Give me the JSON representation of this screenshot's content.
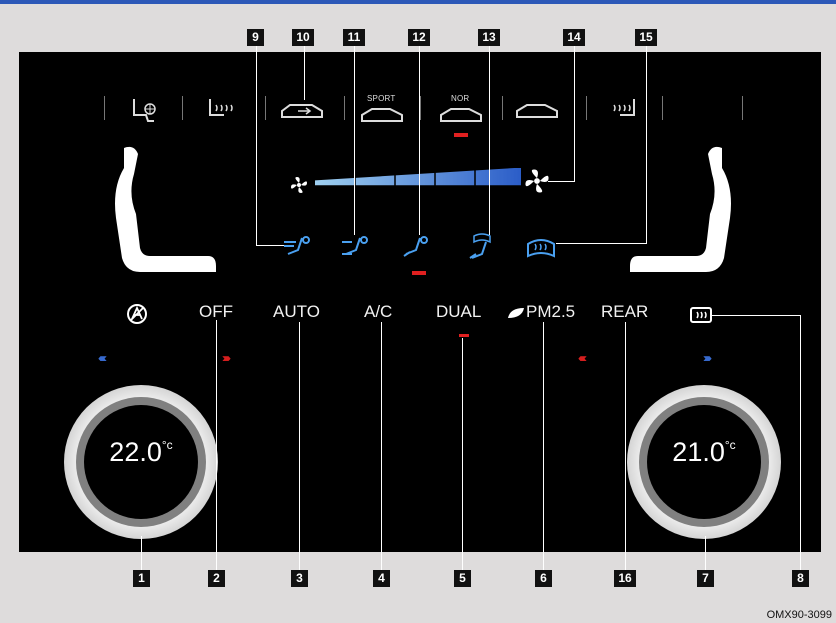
{
  "modes": {
    "sport_label": "SPORT",
    "nor_label": "NOR"
  },
  "buttons": {
    "off": "OFF",
    "auto": "AUTO",
    "ac": "A/C",
    "dual": "DUAL",
    "pm25": "PM2.5",
    "rear": "REAR"
  },
  "left_temp": {
    "value": "22.",
    "decimal": "0",
    "unit": "°c"
  },
  "right_temp": {
    "value": "21.",
    "decimal": "0",
    "unit": "°c"
  },
  "callouts": {
    "c1": "1",
    "c2": "2",
    "c3": "3",
    "c4": "4",
    "c5": "5",
    "c6": "6",
    "c7": "7",
    "c8": "8",
    "c9": "9",
    "c10": "10",
    "c11": "11",
    "c12": "12",
    "c13": "13",
    "c14": "14",
    "c15": "15",
    "c16": "16"
  },
  "fan_level": 0.5,
  "figure_code": "OMX90-3099",
  "colors": {
    "accent_red": "#e02020",
    "accent_blue": "#3a6fd8",
    "panel": "#000000"
  }
}
